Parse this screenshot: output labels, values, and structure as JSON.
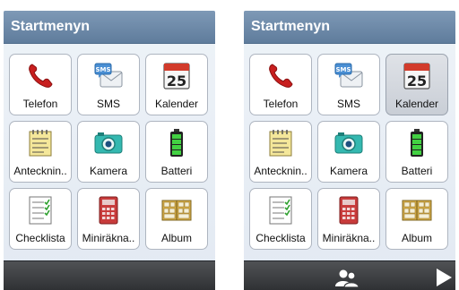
{
  "screens": [
    {
      "title": "Startmenyn",
      "selected": null,
      "footer_buttons": false
    },
    {
      "title": "Startmenyn",
      "selected": "Kalender",
      "footer_buttons": true
    }
  ],
  "apps": [
    {
      "label": "Telefon",
      "icon": "phone-icon"
    },
    {
      "label": "SMS",
      "icon": "sms-icon"
    },
    {
      "label": "Kalender",
      "icon": "calendar-icon",
      "calendar_day": "25"
    },
    {
      "label": "Antecknin..",
      "icon": "notepad-icon"
    },
    {
      "label": "Kamera",
      "icon": "camera-icon"
    },
    {
      "label": "Batteri",
      "icon": "battery-icon"
    },
    {
      "label": "Checklista",
      "icon": "checklist-icon"
    },
    {
      "label": "Miniräkna..",
      "icon": "calculator-icon"
    },
    {
      "label": "Album",
      "icon": "album-icon"
    }
  ],
  "footer": {
    "contacts_icon": "contacts-icon",
    "next_icon": "play-arrow-icon"
  },
  "colors": {
    "header": "#6f8aa9",
    "background": "#e7edf4",
    "footer": "#3a3c3f",
    "tile_border": "#aeb5c0",
    "selected_tile": "#d2d6dc"
  }
}
